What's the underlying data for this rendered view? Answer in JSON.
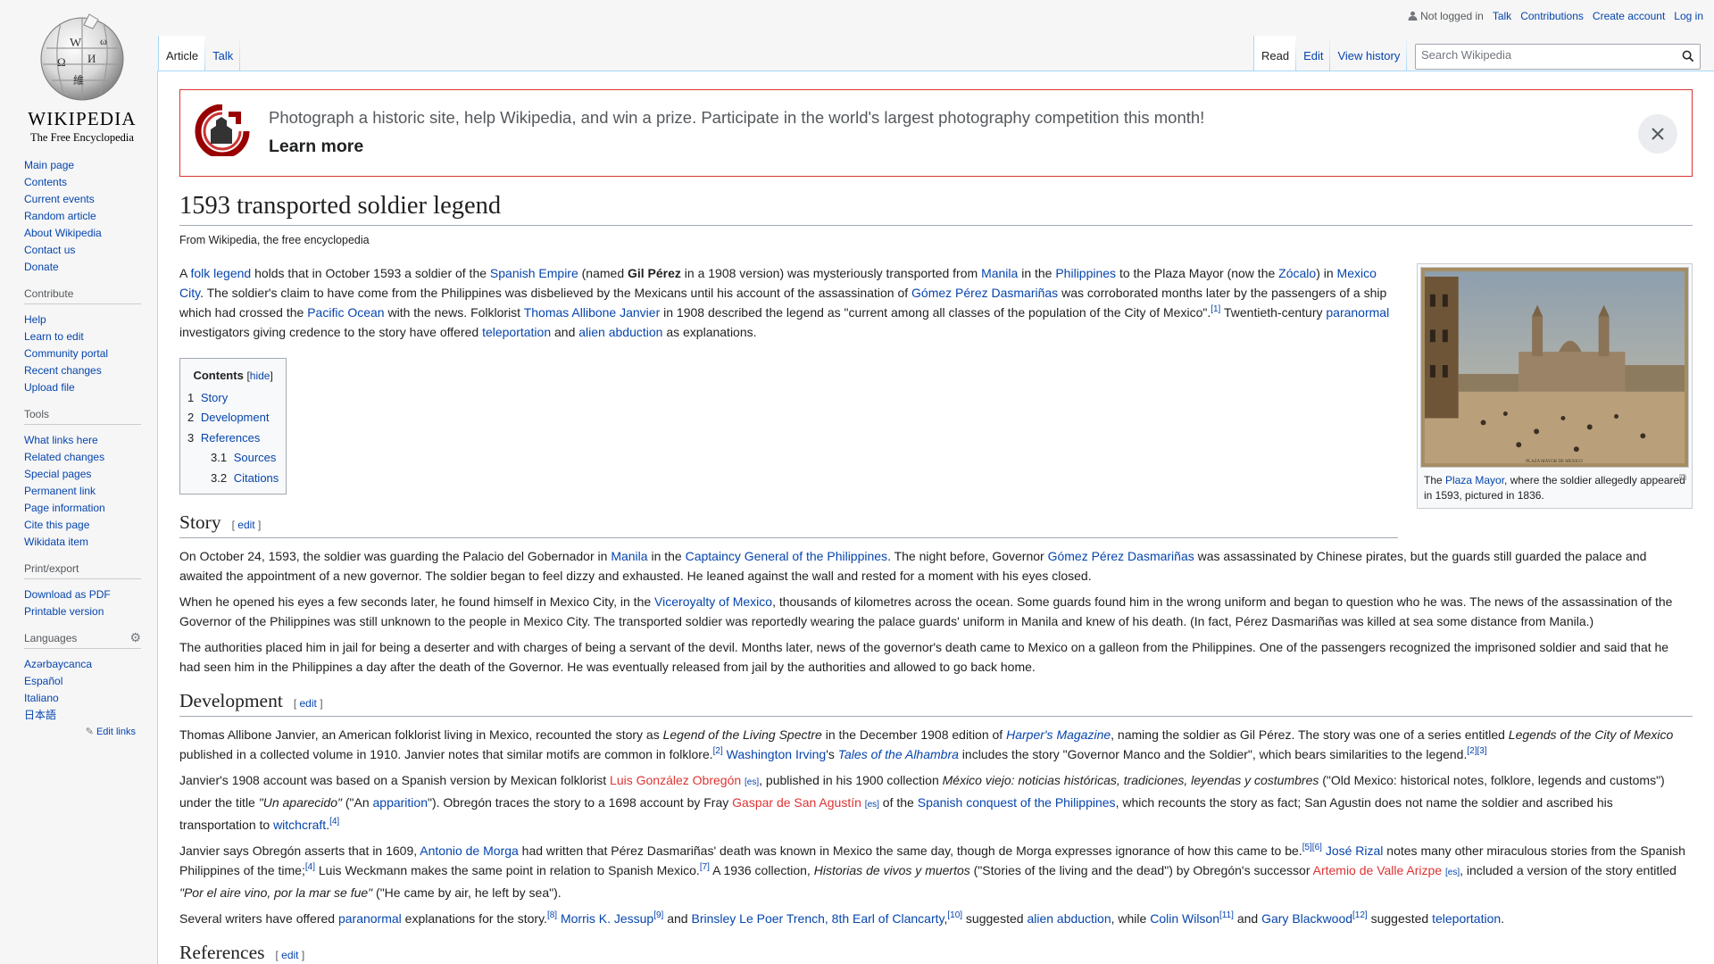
{
  "logo": {
    "wordmark": "WIKIPEDIA",
    "tagline": "The Free Encyclopedia"
  },
  "sidebar": {
    "nav": [
      "Main page",
      "Contents",
      "Current events",
      "Random article",
      "About Wikipedia",
      "Contact us",
      "Donate"
    ],
    "contribute": {
      "title": "Contribute",
      "items": [
        "Help",
        "Learn to edit",
        "Community portal",
        "Recent changes",
        "Upload file"
      ]
    },
    "tools": {
      "title": "Tools",
      "items": [
        "What links here",
        "Related changes",
        "Special pages",
        "Permanent link",
        "Page information",
        "Cite this page",
        "Wikidata item"
      ]
    },
    "print": {
      "title": "Print/export",
      "items": [
        "Download as PDF",
        "Printable version"
      ]
    },
    "languages": {
      "title": "Languages",
      "items": [
        "Azərbaycanca",
        "Español",
        "Italiano",
        "日本語"
      ],
      "edit_links": "Edit links"
    }
  },
  "personal": {
    "not_logged_in": "Not logged in",
    "talk": "Talk",
    "contributions": "Contributions",
    "create_account": "Create account",
    "log_in": "Log in"
  },
  "tabs": {
    "article": "Article",
    "talk": "Talk",
    "read": "Read",
    "edit": "Edit",
    "history": "View history"
  },
  "search": {
    "placeholder": "Search Wikipedia"
  },
  "banner": {
    "text": "Photograph a historic site, help Wikipedia, and win a prize. Participate in the world's largest photography competition this month!",
    "learn_more": "Learn more"
  },
  "article": {
    "title": "1593 transported soldier legend",
    "site_sub": "From Wikipedia, the free encyclopedia",
    "thumb_caption": {
      "pre": "The ",
      "link": "Plaza Mayor",
      "post": ", where the soldier allegedly appeared in 1593, pictured in 1836."
    },
    "toc": {
      "title": "Contents",
      "hide": "hide",
      "items": [
        {
          "num": "1",
          "label": "Story",
          "level": 1
        },
        {
          "num": "2",
          "label": "Development",
          "level": 1
        },
        {
          "num": "3",
          "label": "References",
          "level": 1
        },
        {
          "num": "3.1",
          "label": "Sources",
          "level": 2
        },
        {
          "num": "3.2",
          "label": "Citations",
          "level": 2
        }
      ]
    },
    "edit_label": "edit",
    "sections": {
      "story": "Story",
      "development": "Development",
      "references": "References"
    },
    "paragraphs": {
      "intro": [
        {
          "t": "A "
        },
        {
          "t": "folk legend",
          "l": 1
        },
        {
          "t": " holds that in October 1593 a soldier of the "
        },
        {
          "t": "Spanish Empire",
          "l": 1
        },
        {
          "t": " (named "
        },
        {
          "t": "Gil Pérez",
          "b": 1
        },
        {
          "t": " in a 1908 version) was mysteriously transported from "
        },
        {
          "t": "Manila",
          "l": 1
        },
        {
          "t": " in the "
        },
        {
          "t": "Philippines",
          "l": 1
        },
        {
          "t": " to the Plaza Mayor (now the "
        },
        {
          "t": "Zócalo",
          "l": 1
        },
        {
          "t": ") in "
        },
        {
          "t": "Mexico City",
          "l": 1
        },
        {
          "t": ". The soldier's claim to have come from the Philippines was disbelieved by the Mexicans until his account of the assassination of "
        },
        {
          "t": "Gómez Pérez Dasmariñas",
          "l": 1
        },
        {
          "t": " was corroborated months later by the passengers of a ship which had crossed the "
        },
        {
          "t": "Pacific Ocean",
          "l": 1
        },
        {
          "t": " with the news. Folklorist "
        },
        {
          "t": "Thomas Allibone Janvier",
          "l": 1
        },
        {
          "t": " in 1908 described the legend as \"current among all classes of the population of the City of Mexico\"."
        },
        {
          "t": "[1]",
          "s": 1
        },
        {
          "t": " Twentieth-century "
        },
        {
          "t": "paranormal",
          "l": 1
        },
        {
          "t": " investigators giving credence to the story have offered "
        },
        {
          "t": "teleportation",
          "l": 1
        },
        {
          "t": " and "
        },
        {
          "t": "alien abduction",
          "l": 1
        },
        {
          "t": " as explanations."
        }
      ],
      "story1": [
        {
          "t": "On October 24, 1593, the soldier was guarding the Palacio del Gobernador in "
        },
        {
          "t": "Manila",
          "l": 1
        },
        {
          "t": " in the "
        },
        {
          "t": "Captaincy General of the Philippines",
          "l": 1
        },
        {
          "t": ". The night before, Governor "
        },
        {
          "t": "Gómez Pérez Dasmariñas",
          "l": 1
        },
        {
          "t": " was assassinated by Chinese pirates, but the guards still guarded the palace and awaited the appointment of a new governor. The soldier began to feel dizzy and exhausted. He leaned against the wall and rested for a moment with his eyes closed."
        }
      ],
      "story2": [
        {
          "t": "When he opened his eyes a few seconds later, he found himself in Mexico City, in the "
        },
        {
          "t": "Viceroyalty of Mexico",
          "l": 1
        },
        {
          "t": ", thousands of kilometres across the ocean. Some guards found him in the wrong uniform and began to question who he was. The news of the assassination of the Governor of the Philippines was still unknown to the people in Mexico City. The transported soldier was reportedly wearing the palace guards' uniform in Manila and knew of his death. (In fact, Pérez Dasmariñas was killed at sea some distance from Manila.)"
        }
      ],
      "story3": [
        {
          "t": "The authorities placed him in jail for being a deserter and with charges of being a servant of the devil. Months later, news of the governor's death came to Mexico on a galleon from the Philippines. One of the passengers recognized the imprisoned soldier and said that he had seen him in the Philippines a day after the death of the Governor. He was eventually released from jail by the authorities and allowed to go back home."
        }
      ],
      "dev1": [
        {
          "t": "Thomas Allibone Janvier, an American folklorist living in Mexico, recounted the story as "
        },
        {
          "t": "Legend of the Living Spectre",
          "i": 1
        },
        {
          "t": " in the December 1908 edition of "
        },
        {
          "t": "Harper's Magazine",
          "l": 1,
          "i": 1
        },
        {
          "t": ", naming the soldier as Gil Pérez. The story was one of a series entitled "
        },
        {
          "t": "Legends of the City of Mexico",
          "i": 1
        },
        {
          "t": " published in a collected volume in 1910. Janvier notes that similar motifs are common in folklore."
        },
        {
          "t": "[2]",
          "s": 1
        },
        {
          "t": " "
        },
        {
          "t": "Washington Irving",
          "l": 1
        },
        {
          "t": "'s "
        },
        {
          "t": "Tales of the Alhambra",
          "l": 1,
          "i": 1
        },
        {
          "t": " includes the story \"Governor Manco and the Soldier\", which bears similarities to the legend."
        },
        {
          "t": "[2][3]",
          "s": 1
        }
      ],
      "dev2": [
        {
          "t": "Janvier's 1908 account was based on a Spanish version by Mexican folklorist "
        },
        {
          "t": "Luis González Obregón",
          "r": 1
        },
        {
          "t": " "
        },
        {
          "t": "[es]",
          "e": 1
        },
        {
          "t": ", published in his 1900 collection "
        },
        {
          "t": "México viejo: noticias históricas, tradiciones, leyendas y costumbres",
          "i": 1
        },
        {
          "t": " (\"Old Mexico: historical notes, folklore, legends and customs\") under the title "
        },
        {
          "t": "\"Un aparecido\"",
          "i": 1
        },
        {
          "t": " (\"An "
        },
        {
          "t": "apparition",
          "l": 1
        },
        {
          "t": "\"). Obregón traces the story to a 1698 account by Fray "
        },
        {
          "t": "Gaspar de San Agustín",
          "r": 1
        },
        {
          "t": " "
        },
        {
          "t": "[es]",
          "e": 1
        },
        {
          "t": " of the "
        },
        {
          "t": "Spanish conquest of the Philippines",
          "l": 1
        },
        {
          "t": ", which recounts the story as fact; San Agustin does not name the soldier and ascribed his transportation to "
        },
        {
          "t": "witchcraft",
          "l": 1
        },
        {
          "t": "."
        },
        {
          "t": "[4]",
          "s": 1
        }
      ],
      "dev3": [
        {
          "t": "Janvier says Obregón asserts that in 1609, "
        },
        {
          "t": "Antonio de Morga",
          "l": 1
        },
        {
          "t": " had written that Pérez Dasmariñas' death was known in Mexico the same day, though de Morga expresses ignorance of how this came to be."
        },
        {
          "t": "[5][6]",
          "s": 1
        },
        {
          "t": " "
        },
        {
          "t": "José Rizal",
          "l": 1
        },
        {
          "t": " notes many other miraculous stories from the Spanish Philippines of the time;"
        },
        {
          "t": "[4]",
          "s": 1
        },
        {
          "t": " Luis Weckmann makes the same point in relation to Spanish Mexico."
        },
        {
          "t": "[7]",
          "s": 1
        },
        {
          "t": " A 1936 collection, "
        },
        {
          "t": "Historias de vivos y muertos",
          "i": 1
        },
        {
          "t": " (\"Stories of the living and the dead\") by Obregón's successor "
        },
        {
          "t": "Artemio de Valle Arizpe",
          "r": 1
        },
        {
          "t": " "
        },
        {
          "t": "[es]",
          "e": 1
        },
        {
          "t": ", included a version of the story entitled "
        },
        {
          "t": "\"Por el aire vino, por la mar se fue\"",
          "i": 1
        },
        {
          "t": " (\"He came by air, he left by sea\")."
        }
      ],
      "dev4": [
        {
          "t": "Several writers have offered "
        },
        {
          "t": "paranormal",
          "l": 1
        },
        {
          "t": " explanations for the story."
        },
        {
          "t": "[8]",
          "s": 1
        },
        {
          "t": " "
        },
        {
          "t": "Morris K. Jessup",
          "l": 1
        },
        {
          "t": "[9]",
          "s": 1
        },
        {
          "t": " and "
        },
        {
          "t": "Brinsley Le Poer Trench, 8th Earl of Clancarty",
          "l": 1
        },
        {
          "t": ","
        },
        {
          "t": "[10]",
          "s": 1
        },
        {
          "t": " suggested "
        },
        {
          "t": "alien abduction",
          "l": 1
        },
        {
          "t": ", while "
        },
        {
          "t": "Colin Wilson",
          "l": 1
        },
        {
          "t": "[11]",
          "s": 1
        },
        {
          "t": " and "
        },
        {
          "t": "Gary Blackwood",
          "l": 1
        },
        {
          "t": "[12]",
          "s": 1
        },
        {
          "t": " suggested "
        },
        {
          "t": "teleportation",
          "l": 1
        },
        {
          "t": "."
        }
      ]
    }
  }
}
